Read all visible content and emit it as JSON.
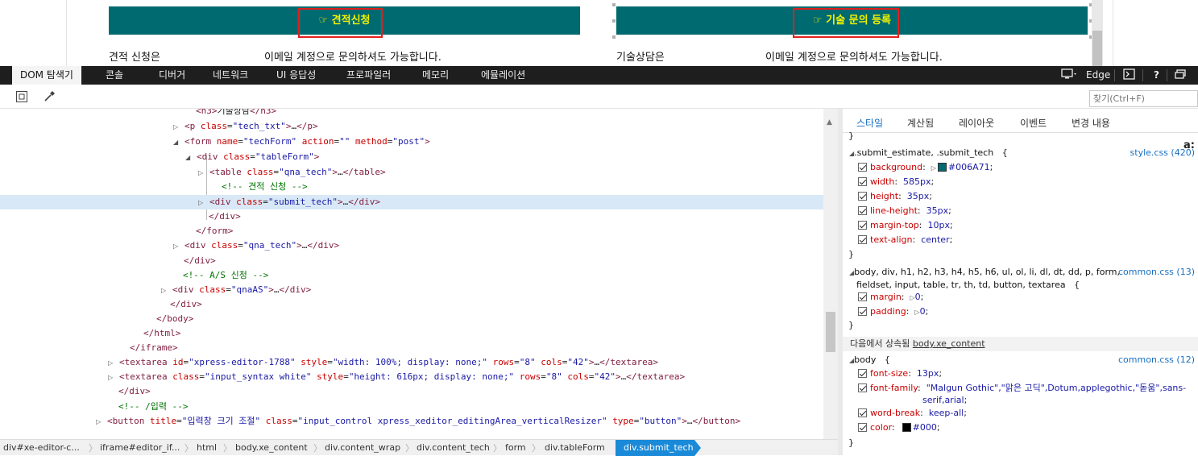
{
  "preview": {
    "estimate_button": "☞ 견적신청",
    "tech_button": "☞ 기술 문의 등록",
    "left_label": "견적 신청은",
    "left_email_text": "이메일 계정으로 문의하셔도 가능합니다.",
    "right_label": "기술상담은",
    "right_email_text": "이메일 계정으로 문의하셔도 가능합니다.",
    "bar_color": "#006A71"
  },
  "tabs": [
    "DOM 탐색기",
    "콘솔",
    "디버거",
    "네트워크",
    "UI 응답성",
    "프로파일러",
    "메모리",
    "에뮬레이션"
  ],
  "toolbar_right": {
    "browser_mode": "Edge",
    "help": "?"
  },
  "find": {
    "placeholder": "찾기(Ctrl+F)"
  },
  "dom_lines": [
    {
      "html": "<span class=\"tg\">&lt;h3&gt;</span><span class=\"tx\">기술상담</span><span class=\"tg\">&lt;/h3&gt;</span>"
    },
    {
      "html": "<span class=\"tg\">&lt;p </span><span class=\"an\">class</span>=<span class=\"av\">\"tech_txt\"</span><span class=\"tg\">&gt;</span>…<span class=\"tg\">&lt;/p&gt;</span>"
    },
    {
      "html": "<span class=\"tg\">&lt;form </span><span class=\"an\">name</span>=<span class=\"av\">\"techForm\"</span> <span class=\"an\">action</span>=<span class=\"av\">\"\"</span> <span class=\"an\">method</span>=<span class=\"av\">\"post\"</span><span class=\"tg\">&gt;</span>"
    },
    {
      "html": "<span class=\"tg\">&lt;div </span><span class=\"an\">class</span>=<span class=\"av\">\"tableForm\"</span><span class=\"tg\">&gt;</span>"
    },
    {
      "html": "<span class=\"tg\">&lt;table </span><span class=\"an\">class</span>=<span class=\"av\">\"qna_tech\"</span><span class=\"tg\">&gt;</span>…<span class=\"tg\">&lt;/table&gt;</span>"
    },
    {
      "html": "<span class=\"cm\">&lt;!-- 견적 신청 --&gt;</span>"
    },
    {
      "html": "<span class=\"tg\">&lt;div </span><span class=\"an\">class</span>=<span class=\"av\">\"submit_tech\"</span><span class=\"tg\">&gt;</span>…<span class=\"tg\">&lt;/div&gt;</span>"
    },
    {
      "html": "<span class=\"tg\">&lt;/div&gt;</span>"
    },
    {
      "html": "<span class=\"tg\">&lt;/form&gt;</span>"
    },
    {
      "html": "<span class=\"tg\">&lt;div </span><span class=\"an\">class</span>=<span class=\"av\">\"qna_tech\"</span><span class=\"tg\">&gt;</span>…<span class=\"tg\">&lt;/div&gt;</span>"
    },
    {
      "html": "<span class=\"tg\">&lt;/div&gt;</span>"
    },
    {
      "html": "<span class=\"cm\">&lt;!-- A/S 신청 --&gt;</span>"
    },
    {
      "html": "<span class=\"tg\">&lt;div </span><span class=\"an\">class</span>=<span class=\"av\">\"qnaAS\"</span><span class=\"tg\">&gt;</span>…<span class=\"tg\">&lt;/div&gt;</span>"
    },
    {
      "html": "<span class=\"tg\">&lt;/div&gt;</span>"
    },
    {
      "html": "<span class=\"tg\">&lt;/body&gt;</span>"
    },
    {
      "html": "<span class=\"tg\">&lt;/html&gt;</span>"
    },
    {
      "html": "<span class=\"tg\">&lt;/iframe&gt;</span>"
    },
    {
      "html": "<span class=\"tg\">&lt;textarea </span><span class=\"an\">id</span>=<span class=\"av\">\"xpress-editor-1788\"</span> <span class=\"an\">style</span>=<span class=\"av\">\"width: 100%; display: none;\"</span> <span class=\"an\">rows</span>=<span class=\"av\">\"8\"</span> <span class=\"an\">cols</span>=<span class=\"av\">\"42\"</span><span class=\"tg\">&gt;</span>…<span class=\"tg\">&lt;/textarea&gt;</span>"
    },
    {
      "html": "<span class=\"tg\">&lt;textarea </span><span class=\"an\">class</span>=<span class=\"av\">\"input_syntax white\"</span> <span class=\"an\">style</span>=<span class=\"av\">\"height: 616px; display: none;\"</span> <span class=\"an\">rows</span>=<span class=\"av\">\"8\"</span> <span class=\"an\">cols</span>=<span class=\"av\">\"42\"</span><span class=\"tg\">&gt;</span>…<span class=\"tg\">&lt;/textarea&gt;</span>"
    },
    {
      "html": "<span class=\"tg\">&lt;/div&gt;</span>"
    },
    {
      "html": "<span class=\"cm\">&lt;!-- /입력 --&gt;</span>"
    },
    {
      "html": "<span class=\"tg\">&lt;button </span><span class=\"an\">title</span>=<span class=\"av\">\"입력창 크기 조절\"</span> <span class=\"an\">class</span>=<span class=\"av\">\"input_control xpress_xeditor_editingArea_verticalResizer\"</span> <span class=\"an\">type</span>=<span class=\"av\">\"button\"</span><span class=\"tg\">&gt;</span>…<span class=\"tg\">&lt;/button&gt;</span>"
    }
  ],
  "breadcrumbs": [
    "div#xe-editor-c...",
    "iframe#editor_if...",
    "html",
    "body.xe_content",
    "div.content_wrap",
    "div.content_tech",
    "form",
    "div.tableForm",
    "div.submit_tech"
  ],
  "style_tabs": [
    "스타일",
    "계산됨",
    "레이아웃",
    "이벤트",
    "변경 내용"
  ],
  "styles": {
    "brace_close": "}",
    "sort_label": "a:",
    "rule1": {
      "selector": ".submit_estimate, .submit_tech",
      "open": "{",
      "source": "style.css (420)",
      "props": [
        {
          "name": "background",
          "value": "#006A71"
        },
        {
          "name": "width",
          "value": "585px"
        },
        {
          "name": "height",
          "value": "35px"
        },
        {
          "name": "line-height",
          "value": "35px"
        },
        {
          "name": "margin-top",
          "value": "10px"
        },
        {
          "name": "text-align",
          "value": "center"
        }
      ]
    },
    "rule2": {
      "selector_l1": "body, div, h1, h2, h3, h4, h5, h6, ul, ol, li, dl, dt, dd, p, form,",
      "selector_l2": "fieldset, input, table, tr, th, td, button, textarea",
      "open": "{",
      "source": "common.css (13)",
      "props": [
        {
          "name": "margin",
          "value": "0"
        },
        {
          "name": "padding",
          "value": "0"
        }
      ]
    },
    "inherited_prefix": "다음에서 상속됨",
    "inherited_from": "body.xe_content",
    "rule3": {
      "selector": "body",
      "open": "{",
      "source": "common.css (12)",
      "props": [
        {
          "name": "font-size",
          "value": "13px"
        },
        {
          "name": "font-family",
          "value": "\"Malgun Gothic\",\"맑은 고딕\",Dotum,applegothic,\"돋움\",sans-"
        },
        {
          "name": "font-family-cont",
          "value": "serif,arial"
        },
        {
          "name": "word-break",
          "value": "keep-all"
        },
        {
          "name": "color",
          "value": "#000"
        }
      ]
    }
  }
}
